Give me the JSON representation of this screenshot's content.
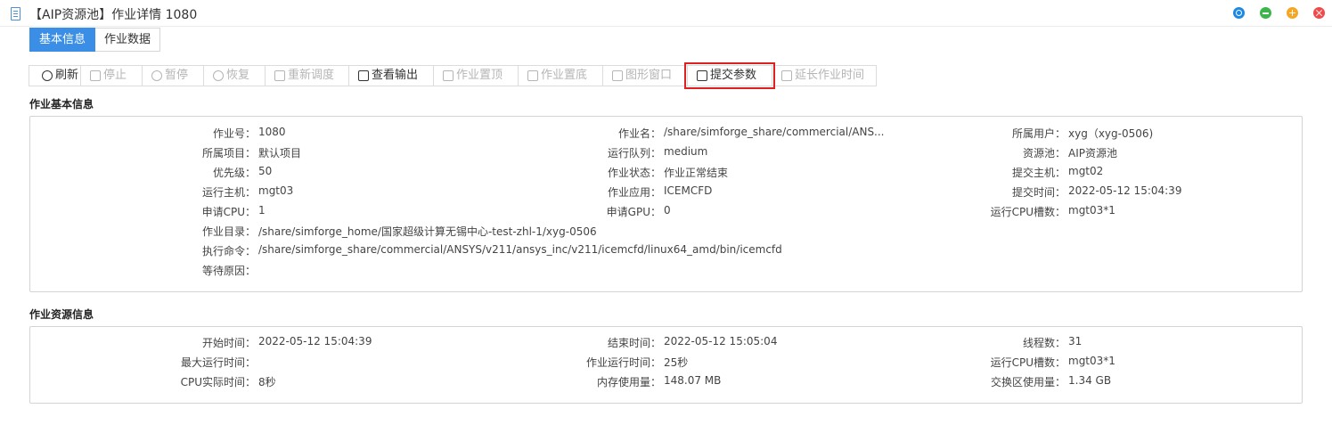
{
  "window": {
    "title": "【AIP资源池】作业详情 1080",
    "controls": [
      "restore",
      "minimize",
      "maximize",
      "close"
    ]
  },
  "tabs": [
    {
      "label": "基本信息",
      "active": true
    },
    {
      "label": "作业数据",
      "active": false
    }
  ],
  "toolbar": {
    "buttons": [
      {
        "label": "刷新",
        "icon": "refresh-icon",
        "enabled": true
      },
      {
        "label": "停止",
        "icon": "stop-icon",
        "enabled": false
      },
      {
        "label": "暂停",
        "icon": "pause-icon",
        "enabled": false
      },
      {
        "label": "恢复",
        "icon": "resume-icon",
        "enabled": false
      },
      {
        "label": "重新调度",
        "icon": "reschedule-icon",
        "enabled": false
      },
      {
        "label": "查看输出",
        "icon": "view-output-icon",
        "enabled": true
      },
      {
        "label": "作业置顶",
        "icon": "pin-top-icon",
        "enabled": false
      },
      {
        "label": "作业置底",
        "icon": "pin-bottom-icon",
        "enabled": false
      },
      {
        "label": "图形窗口",
        "icon": "graphic-window-icon",
        "enabled": false
      },
      {
        "label": "提交参数",
        "icon": "edit-icon",
        "enabled": true,
        "highlighted": true
      },
      {
        "label": "延长作业时间",
        "icon": "edit-icon",
        "enabled": false
      }
    ]
  },
  "basic_info": {
    "title": "作业基本信息",
    "col1": [
      {
        "label": "作业号：",
        "value": "1080"
      },
      {
        "label": "所属项目：",
        "value": "默认项目"
      },
      {
        "label": "优先级：",
        "value": "50"
      },
      {
        "label": "运行主机：",
        "value": "mgt03"
      },
      {
        "label": "申请CPU：",
        "value": "1"
      },
      {
        "label": "作业目录：",
        "value": "/share/simforge_home/国家超级计算无锡中心-test-zhl-1/xyg-0506"
      },
      {
        "label": "执行命令：",
        "value": "/share/simforge_share/commercial/ANSYS/v211/ansys_inc/v211/icemcfd/linux64_amd/bin/icemcfd"
      },
      {
        "label": "等待原因：",
        "value": ""
      }
    ],
    "col2": [
      {
        "label": "作业名：",
        "value": "/share/simforge_share/commercial/ANS..."
      },
      {
        "label": "运行队列：",
        "value": "medium"
      },
      {
        "label": "作业状态：",
        "value": "作业正常结束"
      },
      {
        "label": "作业应用：",
        "value": "ICEMCFD"
      },
      {
        "label": "申请GPU：",
        "value": "0"
      }
    ],
    "col3": [
      {
        "label": "所属用户：",
        "value": "xyg（xyg-0506)"
      },
      {
        "label": "资源池：",
        "value": "AIP资源池"
      },
      {
        "label": "提交主机：",
        "value": "mgt02"
      },
      {
        "label": "提交时间：",
        "value": "2022-05-12 15:04:39"
      },
      {
        "label": "运行CPU槽数：",
        "value": "mgt03*1"
      }
    ]
  },
  "resource_info": {
    "title": "作业资源信息",
    "col1": [
      {
        "label": "开始时间：",
        "value": "2022-05-12 15:04:39"
      },
      {
        "label": "最大运行时间：",
        "value": ""
      },
      {
        "label": "CPU实际时间：",
        "value": "8秒"
      }
    ],
    "col2": [
      {
        "label": "结束时间：",
        "value": "2022-05-12 15:05:04"
      },
      {
        "label": "作业运行时间：",
        "value": "25秒"
      },
      {
        "label": "内存使用量：",
        "value": "148.07 MB"
      }
    ],
    "col3": [
      {
        "label": "线程数：",
        "value": "31"
      },
      {
        "label": "运行CPU槽数：",
        "value": "mgt03*1"
      },
      {
        "label": "交换区使用量：",
        "value": "1.34 GB"
      }
    ]
  }
}
